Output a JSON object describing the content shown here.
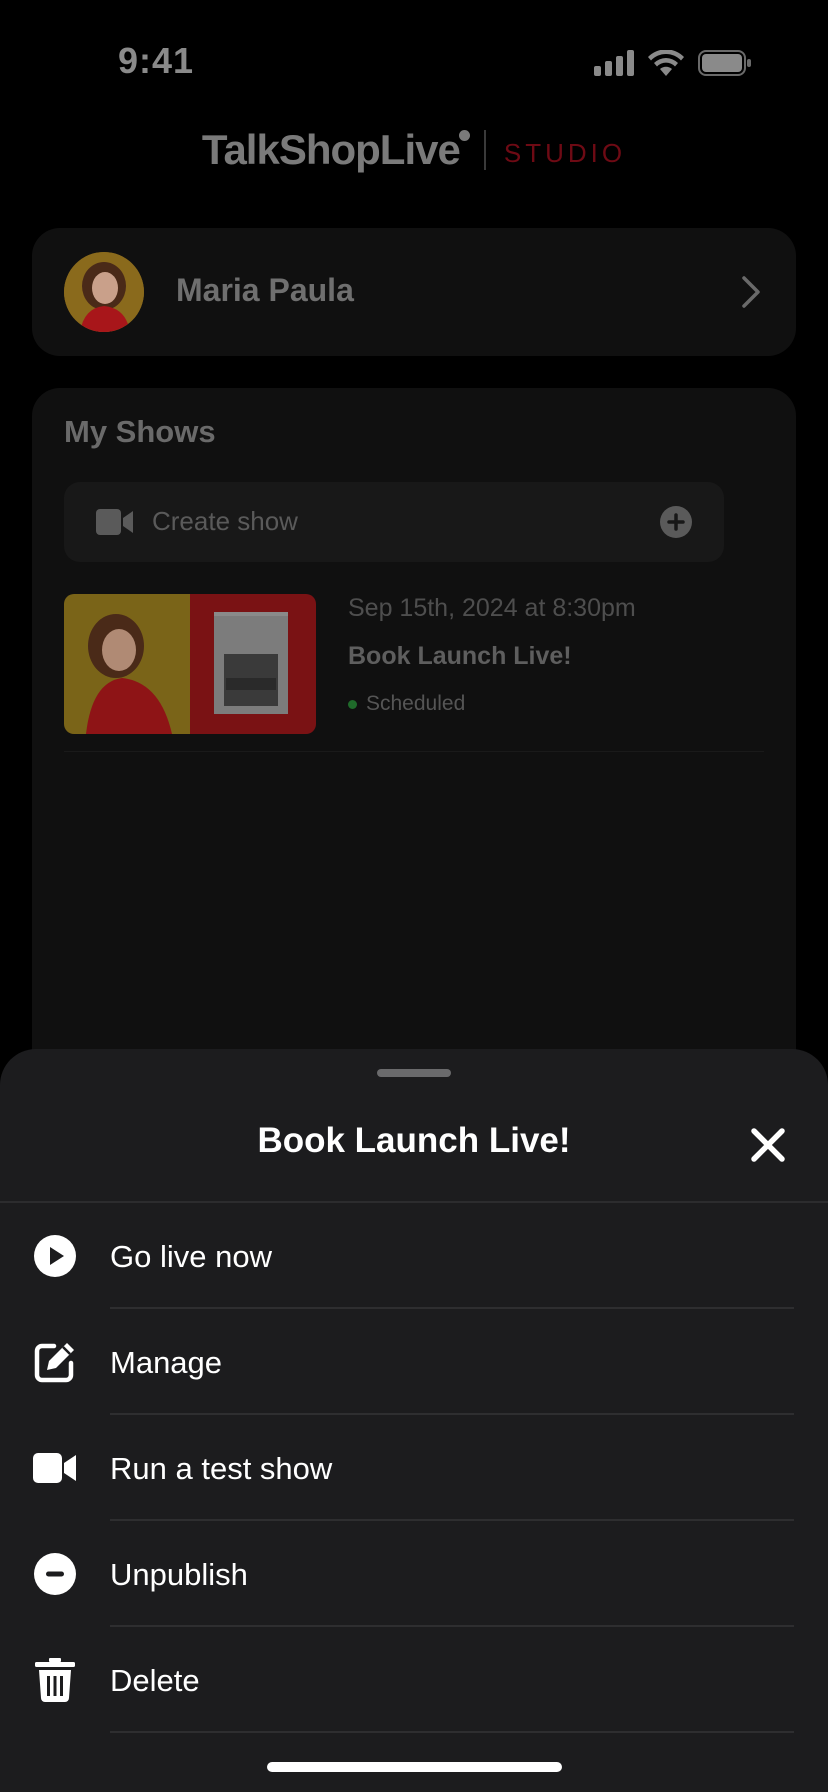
{
  "status_bar": {
    "time": "9:41"
  },
  "brand": {
    "name": "TalkShopLive",
    "studio": "STUDIO",
    "studio_color": "#6e0a14"
  },
  "profile": {
    "name": "Maria Paula"
  },
  "shows": {
    "title": "My Shows",
    "create_label": "Create show",
    "items": [
      {
        "date": "Sep 15th, 2024 at 8:30pm",
        "title": "Book Launch Live!",
        "status": "Scheduled",
        "status_color": "#1f6a2a"
      }
    ]
  },
  "sheet": {
    "title": "Book Launch Live!",
    "items": [
      {
        "label": "Go live now",
        "icon": "play-circle-icon"
      },
      {
        "label": "Manage",
        "icon": "edit-icon"
      },
      {
        "label": "Run a test show",
        "icon": "video-camera-icon"
      },
      {
        "label": "Unpublish",
        "icon": "minus-circle-icon"
      },
      {
        "label": "Delete",
        "icon": "trash-icon"
      }
    ]
  }
}
